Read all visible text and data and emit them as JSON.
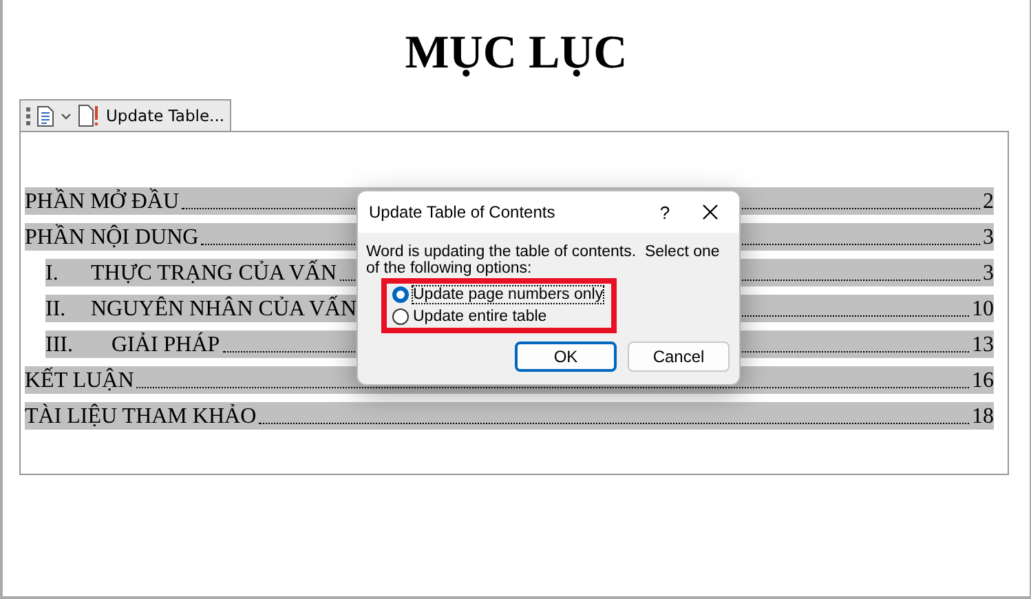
{
  "document": {
    "title": "MỤC LỤC",
    "toc_control": {
      "label": "Update Table..."
    },
    "toc": [
      {
        "text": "PHẦN MỞ ĐẦU",
        "page": "2"
      },
      {
        "text": "PHẦN NỘI DUNG",
        "page": "3",
        "children": [
          {
            "number": "I.",
            "text": "THỰC TRẠNG CỦA VẤN",
            "page": "3"
          },
          {
            "number": "II.",
            "text": "NGUYÊN NHÂN CỦA VẤN",
            "page": "10"
          },
          {
            "number": "III.",
            "text": "GIẢI PHÁP",
            "page": "13"
          }
        ]
      },
      {
        "text": "KẾT LUẬN",
        "page": "16"
      },
      {
        "text": "TÀI LIỆU THAM KHẢO",
        "page": "18"
      }
    ]
  },
  "dialog": {
    "title": "Update Table of Contents",
    "help": "?",
    "message": "Word is updating the table of contents.  Select one of the following options:",
    "options": [
      {
        "label": "Update page numbers only",
        "selected": true
      },
      {
        "label": "Update entire table",
        "selected": false
      }
    ],
    "buttons": [
      {
        "label": "OK",
        "default": true
      },
      {
        "label": "Cancel",
        "default": false
      }
    ]
  }
}
